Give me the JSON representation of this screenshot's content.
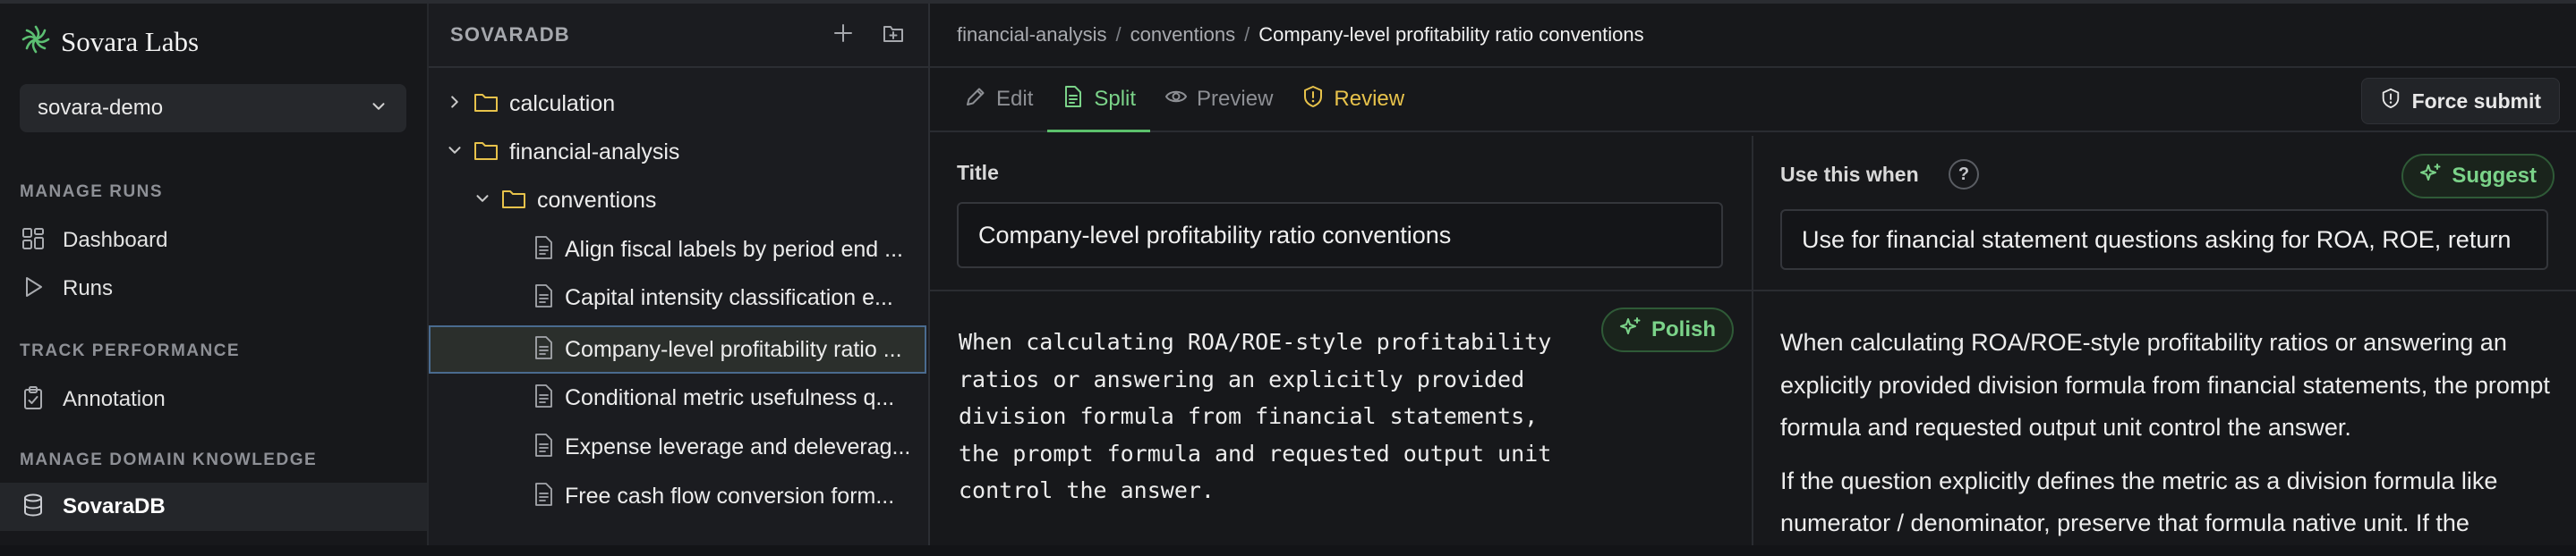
{
  "brand": {
    "name": "Sovara Labs",
    "logo_icon": "flower-logo-icon",
    "logo_color": "#5cbf72"
  },
  "workspace": {
    "selected": "sovara-demo"
  },
  "sidebar": {
    "sections": [
      {
        "label": "MANAGE RUNS"
      },
      {
        "label": "TRACK PERFORMANCE"
      },
      {
        "label": "MANAGE DOMAIN KNOWLEDGE"
      }
    ],
    "items": [
      {
        "label": "Dashboard",
        "icon": "grid-icon"
      },
      {
        "label": "Runs",
        "icon": "play-icon"
      },
      {
        "label": "Annotation",
        "icon": "clipboard-icon"
      },
      {
        "label": "SovaraDB",
        "icon": "database-icon",
        "active": true
      }
    ]
  },
  "tree": {
    "title": "SOVARADB",
    "rows": [
      {
        "label": "calculation",
        "type": "folder",
        "expanded": false
      },
      {
        "label": "financial-analysis",
        "type": "folder",
        "expanded": true
      },
      {
        "label": "conventions",
        "type": "folder",
        "expanded": true
      },
      {
        "label": "Align fiscal labels by period end ...",
        "type": "file"
      },
      {
        "label": "Capital intensity classification e...",
        "type": "file"
      },
      {
        "label": "Company-level profitability ratio ...",
        "type": "file",
        "selected": true
      },
      {
        "label": "Conditional metric usefulness q...",
        "type": "file"
      },
      {
        "label": "Expense leverage and deleverag...",
        "type": "file"
      },
      {
        "label": "Free cash flow conversion form...",
        "type": "file"
      }
    ]
  },
  "breadcrumb": {
    "part1": "financial-analysis",
    "part2": "conventions",
    "current": "Company-level profitability ratio conventions"
  },
  "tabs": {
    "edit": "Edit",
    "split": "Split",
    "preview": "Preview",
    "review": "Review"
  },
  "force_submit": "Force submit",
  "editor": {
    "title_label": "Title",
    "title_value": "Company-level profitability ratio conventions",
    "use_when_label": "Use this when",
    "use_when_value": "Use for financial statement questions asking for ROA, ROE, return",
    "suggest_label": "Suggest",
    "polish_label": "Polish",
    "body": "When calculating ROA/ROE-style profitability\nratios or answering an explicitly provided\ndivision formula from financial statements,\nthe prompt formula and requested output unit\ncontrol the answer."
  },
  "preview": {
    "p1": "When calculating ROA/ROE-style profitability ratios or answering an explicitly provided division formula from financial statements, the prompt formula and requested output unit control the answer.",
    "p2": "If the question explicitly defines the metric as a division formula like numerator / denominator, preserve that formula native unit. If the"
  },
  "colors": {
    "accent_green": "#5cc16c",
    "review_yellow": "#e7c24b",
    "selection_border": "#4a6b8f"
  }
}
